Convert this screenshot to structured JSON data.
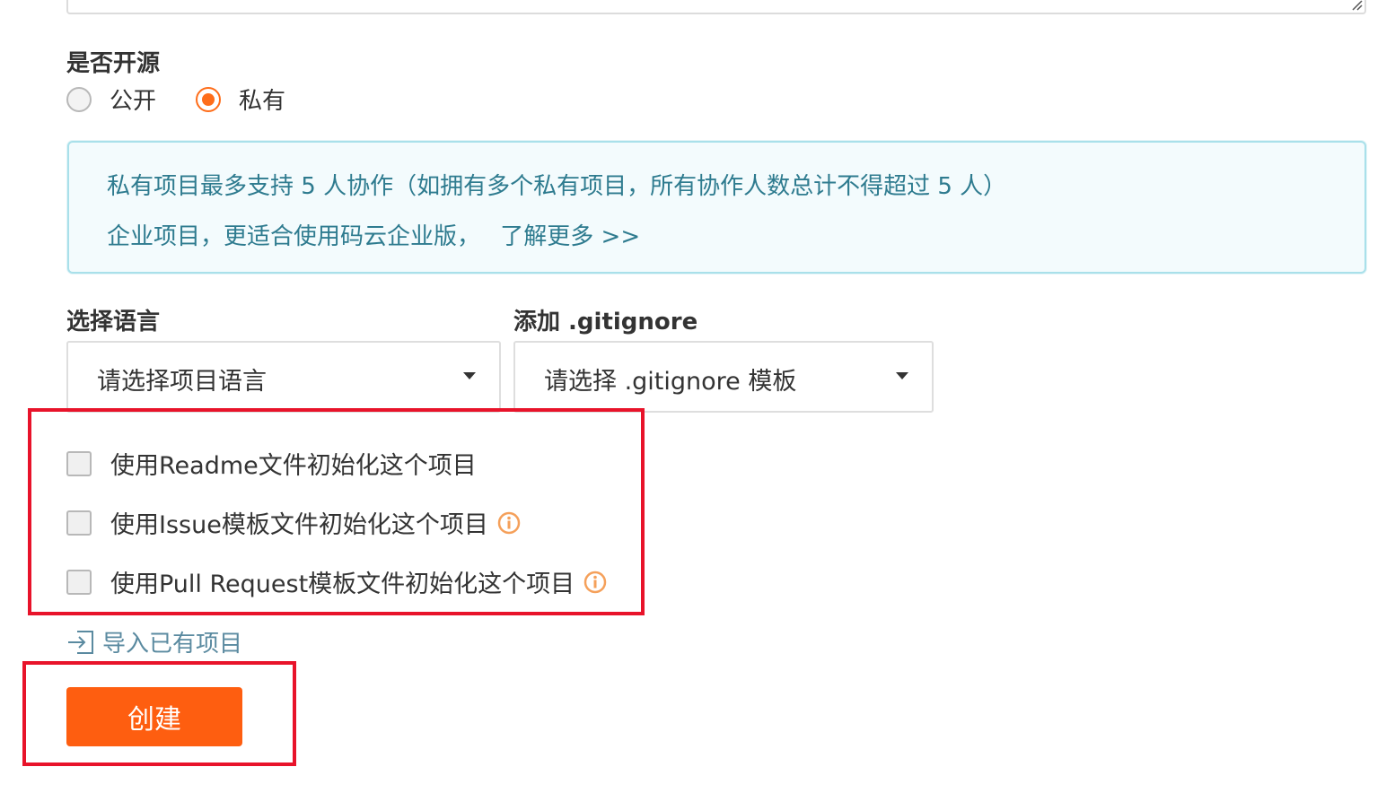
{
  "visibility": {
    "label": "是否开源",
    "options": [
      {
        "label": "公开",
        "selected": false
      },
      {
        "label": "私有",
        "selected": true
      }
    ]
  },
  "notice": {
    "line1": "私有项目最多支持 5 人协作（如拥有多个私有项目，所有协作人数总计不得超过 5 人）",
    "line2_text": "企业项目，更适合使用码云企业版，",
    "line2_link": "了解更多 >>"
  },
  "language": {
    "label": "选择语言",
    "placeholder": "请选择项目语言"
  },
  "gitignore": {
    "label": "添加 .gitignore",
    "placeholder": "请选择 .gitignore 模板"
  },
  "init_options": [
    {
      "label": "使用Readme文件初始化这个项目",
      "checked": false,
      "has_info_icon": false
    },
    {
      "label": "使用Issue模板文件初始化这个项目",
      "checked": false,
      "has_info_icon": true
    },
    {
      "label": "使用Pull Request模板文件初始化这个项目",
      "checked": false,
      "has_info_icon": true
    }
  ],
  "import_link": {
    "label": "导入已有项目",
    "icon": "import-icon"
  },
  "create_button": {
    "label": "创建"
  },
  "colors": {
    "accent": "#fe5e10",
    "highlight_border": "#e8132a",
    "notice_text": "#2e7b8f",
    "notice_bg": "#f3fbfd",
    "info_icon": "#f5a05a"
  }
}
